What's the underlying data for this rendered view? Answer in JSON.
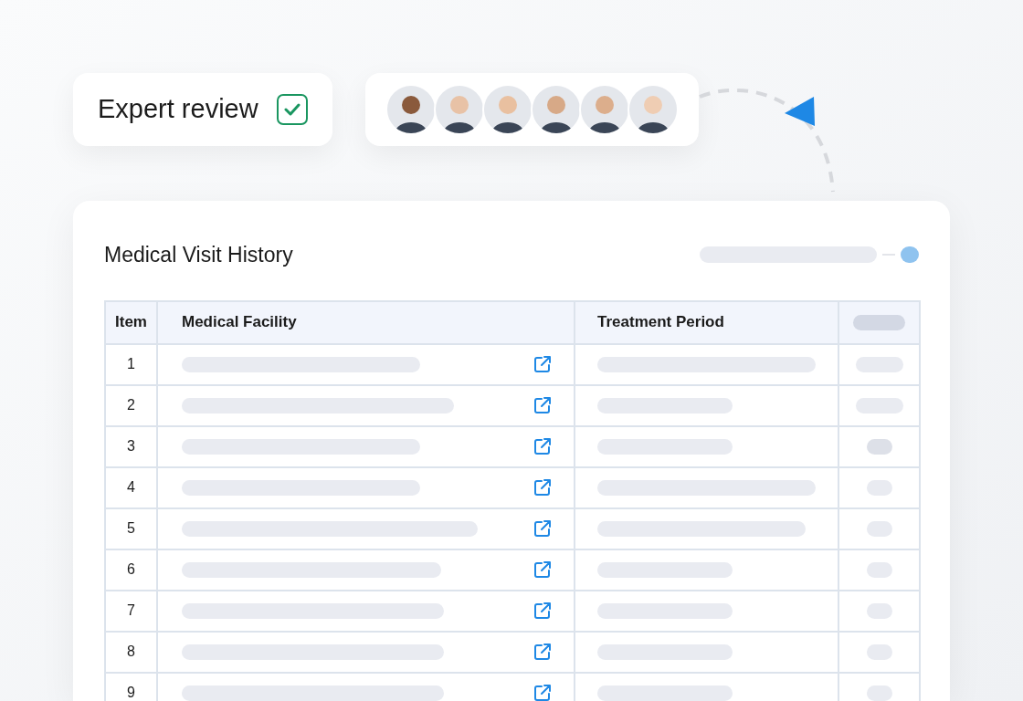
{
  "review_badge": {
    "label": "Expert review",
    "checked": true
  },
  "table_card": {
    "title": "Medical Visit History",
    "columns": [
      "Item",
      "Medical Facility",
      "Treatment Period"
    ],
    "rows": [
      {
        "item": "1"
      },
      {
        "item": "2"
      },
      {
        "item": "3"
      },
      {
        "item": "4"
      },
      {
        "item": "5"
      },
      {
        "item": "6"
      },
      {
        "item": "7"
      },
      {
        "item": "8"
      },
      {
        "item": "9"
      }
    ]
  }
}
